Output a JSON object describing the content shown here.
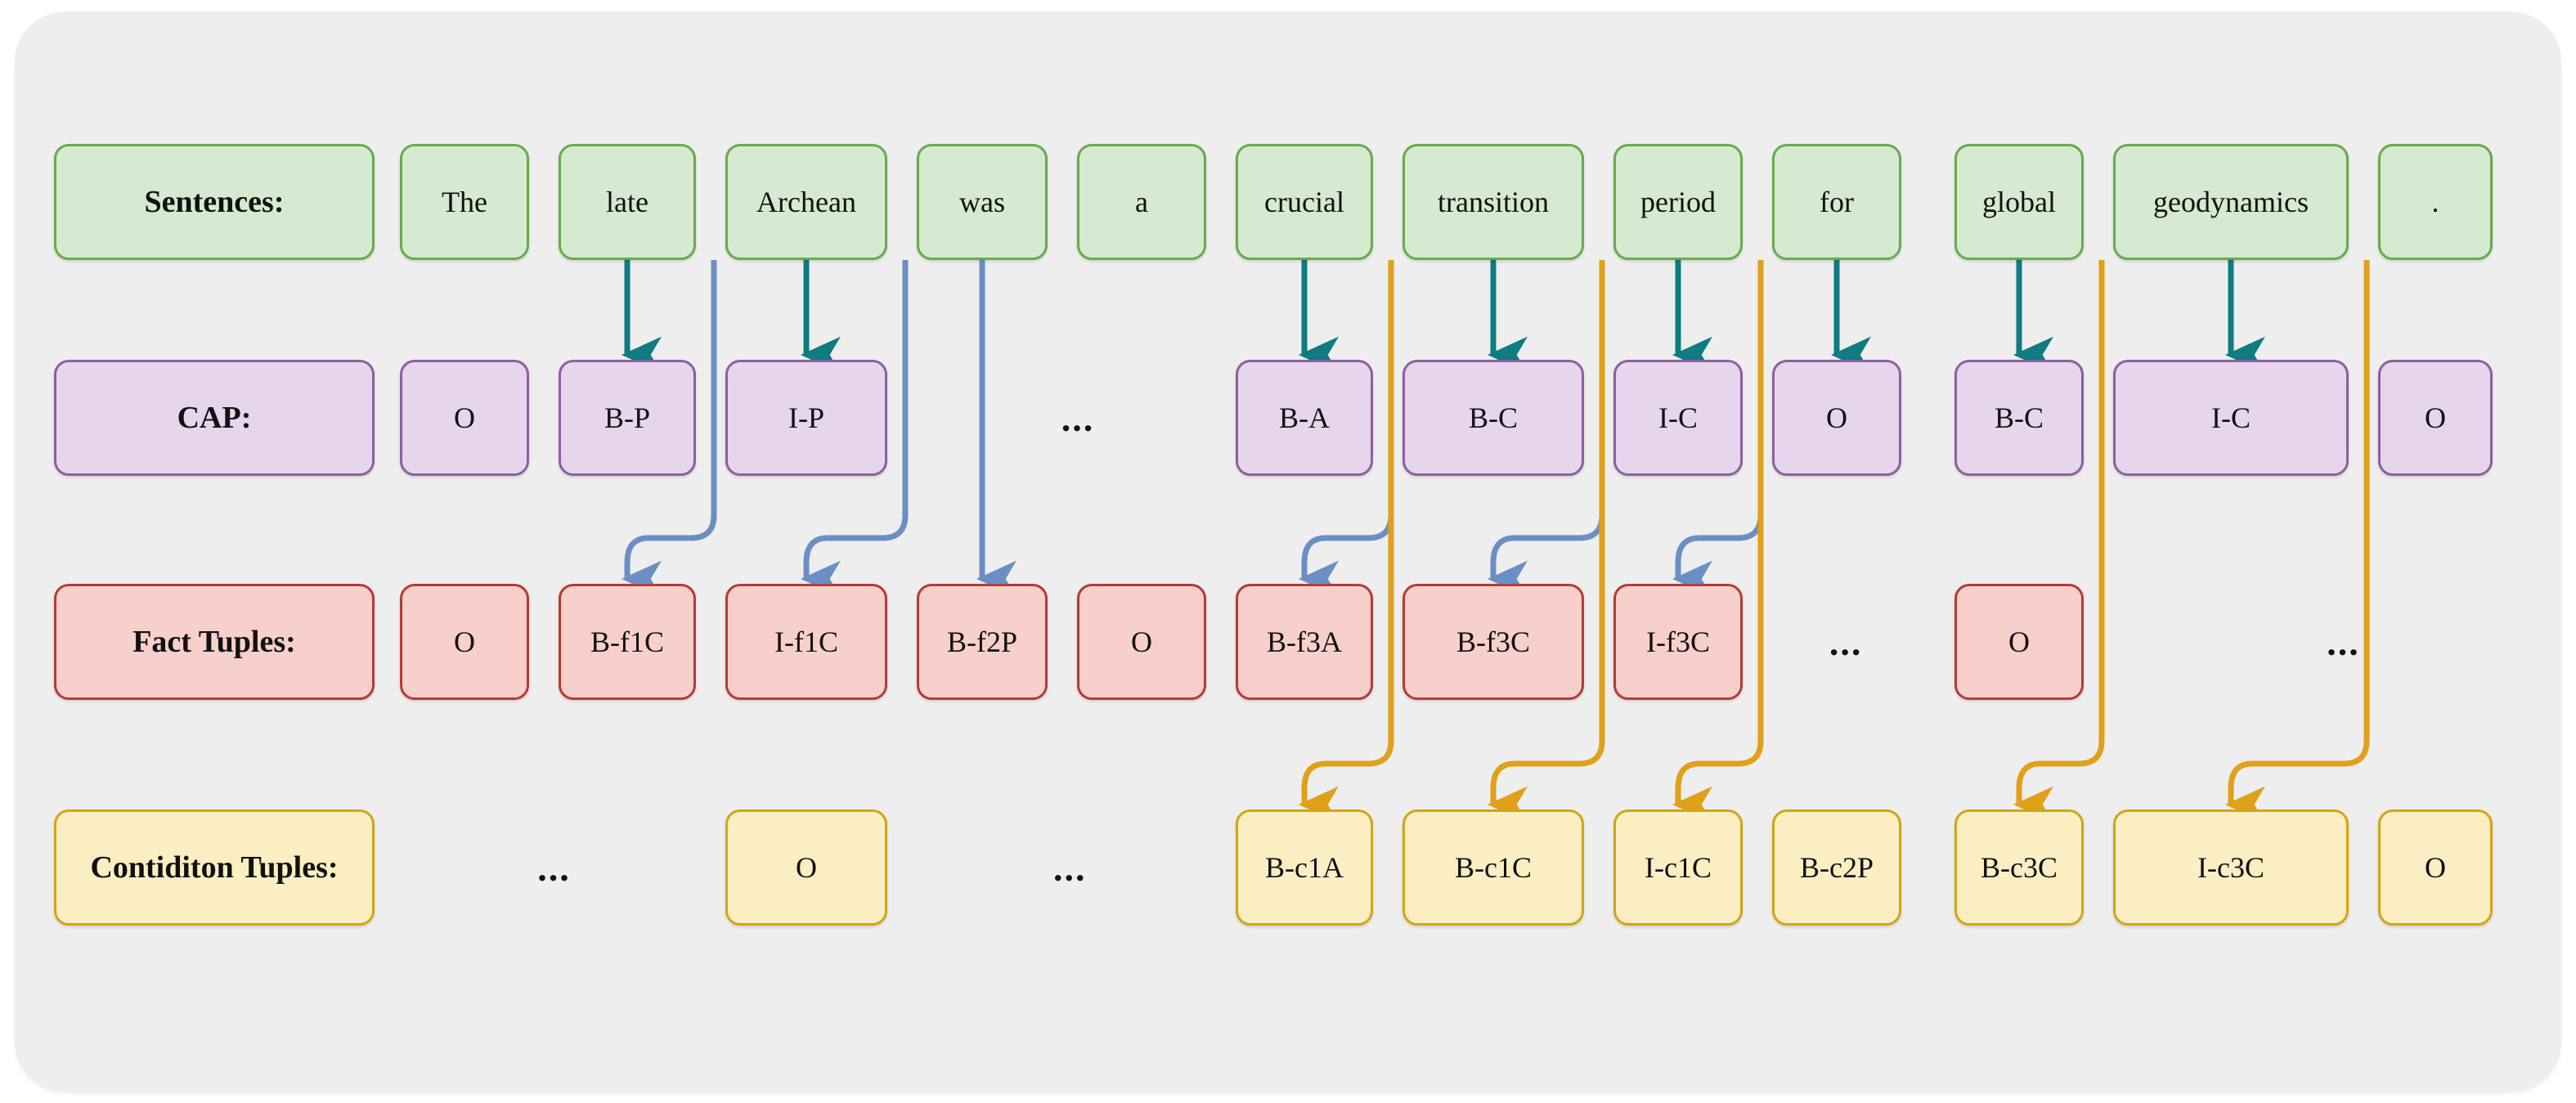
{
  "figure": {
    "title": "CAP / Fact Tuples / Condition Tuples sequence labeling diagram",
    "colors": {
      "panel_bg": "#eeeeee",
      "sentence_fill": "#d5ead0",
      "sentence_border": "#67ab4e",
      "cap_fill": "#e6d5ec",
      "cap_border": "#8e5ea2",
      "fact_fill": "#f7cfcb",
      "fact_border": "#b73a36",
      "cond_fill": "#fbeec2",
      "cond_border": "#d2a613",
      "arrow_teal": "#0e7c80",
      "arrow_blue": "#6b8fc4",
      "arrow_orange": "#dfa01a"
    }
  },
  "rows": [
    {
      "key": "sentences",
      "label": "Sentences:",
      "cells": [
        {
          "text": "The"
        },
        {
          "text": "late"
        },
        {
          "text": "Archean"
        },
        {
          "text": "was"
        },
        {
          "text": "a"
        },
        {
          "text": "crucial"
        },
        {
          "text": "transition"
        },
        {
          "text": "period"
        },
        {
          "text": "for"
        },
        {
          "text": "global"
        },
        {
          "text": "geodynamics"
        },
        {
          "text": "."
        }
      ],
      "ellipses": []
    },
    {
      "key": "cap",
      "label": "CAP:",
      "cells": [
        {
          "text": "O"
        },
        {
          "text": "B-P"
        },
        {
          "text": "I-P"
        },
        {
          "text": "B-A"
        },
        {
          "text": "B-C"
        },
        {
          "text": "I-C"
        },
        {
          "text": "O"
        },
        {
          "text": "B-C"
        },
        {
          "text": "I-C"
        },
        {
          "text": "O"
        }
      ],
      "ellipses": [
        {
          "text": "..."
        }
      ]
    },
    {
      "key": "fact_tuples",
      "label": "Fact Tuples:",
      "cells": [
        {
          "text": "O"
        },
        {
          "text": "B-f1C"
        },
        {
          "text": "I-f1C"
        },
        {
          "text": "B-f2P"
        },
        {
          "text": "O"
        },
        {
          "text": "B-f3A"
        },
        {
          "text": "B-f3C"
        },
        {
          "text": "I-f3C"
        },
        {
          "text": "O"
        }
      ],
      "ellipses": [
        {
          "text": "..."
        },
        {
          "text": "..."
        }
      ]
    },
    {
      "key": "condition_tuples",
      "label": "Contiditon Tuples:",
      "cells": [
        {
          "text": "O"
        },
        {
          "text": "B-c1A"
        },
        {
          "text": "B-c1C"
        },
        {
          "text": "I-c1C"
        },
        {
          "text": "B-c2P"
        },
        {
          "text": "B-c3C"
        },
        {
          "text": "I-c3C"
        },
        {
          "text": "O"
        }
      ],
      "ellipses": [
        {
          "text": "..."
        },
        {
          "text": "..."
        }
      ]
    }
  ],
  "legend_notes": {
    "teal_arrow": "sentence-token-to-cap-tag",
    "blue_arrow": "sentence-token-to-fact-tuple-tag",
    "orange_arrow": "sentence-token-to-condition-tuple-tag"
  }
}
